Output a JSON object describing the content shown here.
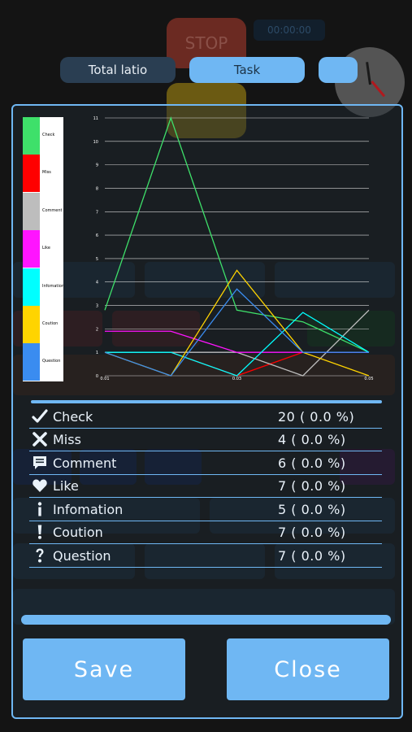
{
  "tabs": {
    "total": "Total latio",
    "task": "Task"
  },
  "background": {
    "stop_label": "STOP",
    "timer": "00:00:00"
  },
  "colors": {
    "accent": "#6fb7f3",
    "check": "#3ee06a",
    "miss": "#ff0000",
    "comment": "#bdbdbd",
    "like": "#ff14ff",
    "info": "#00ffff",
    "caution": "#ffd400",
    "question": "#3a8cf0"
  },
  "chart_data": {
    "type": "line",
    "x": [
      "0.01",
      "0.02",
      "0.03",
      "0.04",
      "0.05"
    ],
    "x_tick_labels": [
      "0.01",
      "0.03",
      "0.05"
    ],
    "ylim": [
      0,
      11
    ],
    "y_ticks": [
      0,
      1,
      2,
      3,
      4,
      5,
      6,
      7,
      8,
      9,
      10,
      11
    ],
    "grid": true,
    "legend_position": "left",
    "series": [
      {
        "name": "Check",
        "color": "#3ee06a",
        "values": [
          2.8,
          11,
          2.8,
          2.3,
          1
        ]
      },
      {
        "name": "Miss",
        "color": "#ff0000",
        "values": [
          1,
          1,
          0,
          1,
          1
        ]
      },
      {
        "name": "Comment",
        "color": "#bdbdbd",
        "values": [
          1,
          1,
          1,
          0,
          2.8
        ]
      },
      {
        "name": "Like",
        "color": "#ff14ff",
        "values": [
          1.9,
          1.9,
          1,
          1,
          1
        ]
      },
      {
        "name": "Infomation",
        "color": "#00ffff",
        "values": [
          1,
          1,
          0,
          2.7,
          1
        ]
      },
      {
        "name": "Coution",
        "color": "#ffd400",
        "values": [
          1,
          0,
          4.5,
          1,
          0
        ]
      },
      {
        "name": "Question",
        "color": "#3a8cf0",
        "values": [
          1,
          0,
          3.7,
          1,
          1
        ]
      }
    ]
  },
  "stats": [
    {
      "label": "Check",
      "value": "20 ( 0.0 %)",
      "icon": "check-icon"
    },
    {
      "label": "Miss",
      "value": "4 ( 0.0 %)",
      "icon": "cross-icon"
    },
    {
      "label": "Comment",
      "value": "6 ( 0.0 %)",
      "icon": "comment-icon"
    },
    {
      "label": "Like",
      "value": "7 ( 0.0 %)",
      "icon": "heart-icon"
    },
    {
      "label": "Infomation",
      "value": "5 ( 0.0 %)",
      "icon": "info-icon"
    },
    {
      "label": "Coution",
      "value": "7 ( 0.0 %)",
      "icon": "exclamation-icon"
    },
    {
      "label": "Question",
      "value": "7 ( 0.0 %)",
      "icon": "question-icon"
    }
  ],
  "buttons": {
    "save": "Save",
    "close": "Close"
  }
}
